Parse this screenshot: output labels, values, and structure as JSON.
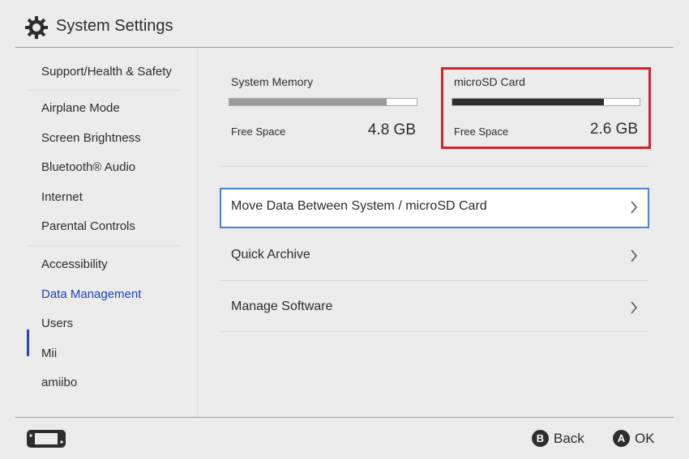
{
  "header": {
    "title": "System Settings",
    "icon": "gear-icon"
  },
  "sidebar": {
    "active_color": "#1f3fbd",
    "items": [
      {
        "label": "Support/Health & Safety",
        "active": false
      },
      {
        "label": "Airplane Mode",
        "active": false
      },
      {
        "label": "Screen Brightness",
        "active": false
      },
      {
        "label": "Bluetooth® Audio",
        "active": false
      },
      {
        "label": "Internet",
        "active": false
      },
      {
        "label": "Parental Controls",
        "active": false
      },
      {
        "label": "Accessibility",
        "active": false
      },
      {
        "label": "Data Management",
        "active": true
      },
      {
        "label": "Users",
        "active": false
      },
      {
        "label": "Mii",
        "active": false
      },
      {
        "label": "amiibo",
        "active": false
      }
    ]
  },
  "storage": {
    "system": {
      "label": "System Memory",
      "free_label": "Free Space",
      "free_value": "4.8 GB",
      "used_fraction": 0.84,
      "fill_color": "#9a9a9a"
    },
    "sd": {
      "label": "microSD Card",
      "free_label": "Free Space",
      "free_value": "2.6 GB",
      "used_fraction": 0.81,
      "fill_color": "#2d2d2d",
      "highlight_color": "#d42228"
    }
  },
  "options": [
    {
      "label": "Move Data Between System / microSD Card",
      "selected": true
    },
    {
      "label": "Quick Archive",
      "selected": false
    },
    {
      "label": "Manage Software",
      "selected": false
    }
  ],
  "footer": {
    "console_icon": "handheld-console-icon",
    "back": {
      "button": "B",
      "label": "Back"
    },
    "ok": {
      "button": "A",
      "label": "OK"
    }
  },
  "colors": {
    "background": "#ebebeb",
    "selection_border": "#4a84d6",
    "text": "#2d2d2d"
  }
}
